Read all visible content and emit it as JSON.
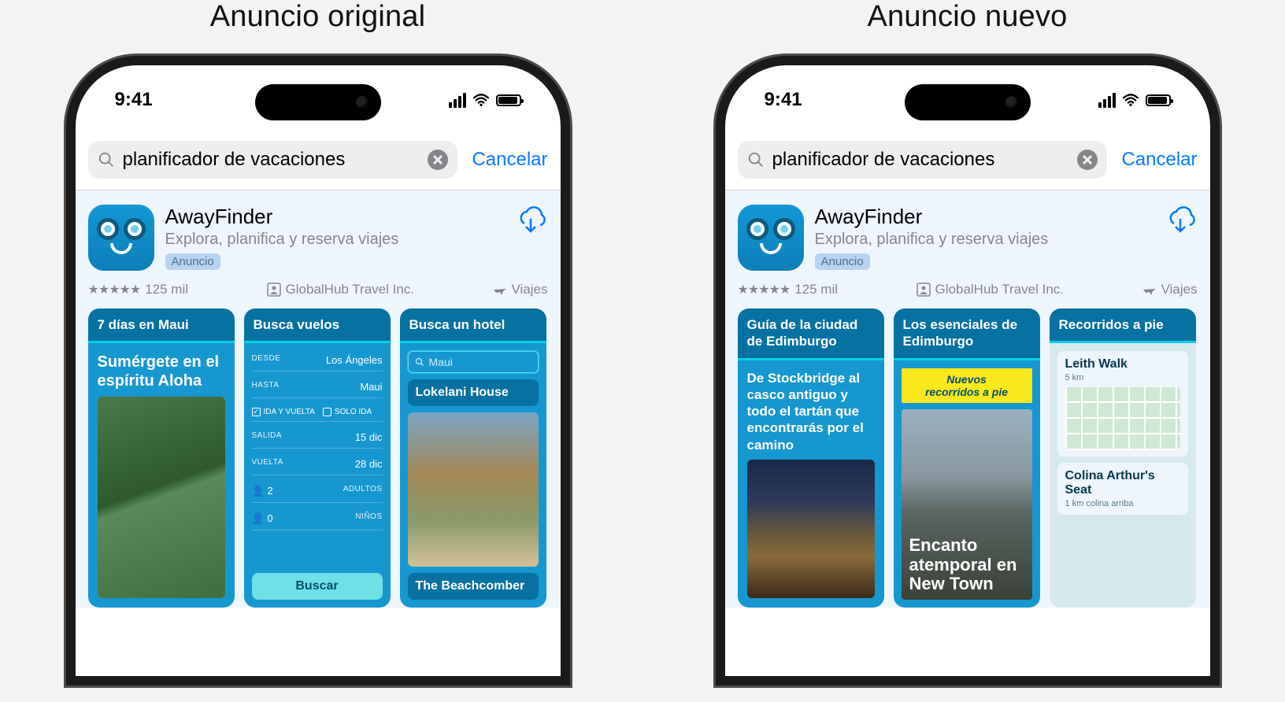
{
  "left": {
    "title": "Anuncio original",
    "status_time": "9:41",
    "search_value": "planificador de vacaciones",
    "cancel": "Cancelar",
    "app": {
      "name": "AwayFinder",
      "subtitle": "Explora, planifica y reserva viajes",
      "ad_label": "Anuncio"
    },
    "meta": {
      "rating_count": "125 mil",
      "developer": "GlobalHub Travel Inc.",
      "category": "Viajes"
    },
    "cards": [
      {
        "title": "7 días en Maui",
        "subhead": "Sumérgete en el espíritu Aloha"
      },
      {
        "title": "Busca vuelos",
        "from_lbl": "DESDE",
        "from_val": "Los Ángeles",
        "to_lbl": "HASTA",
        "to_val": "Maui",
        "cb1": "IDA Y VUELTA",
        "cb2": "SOLO IDA",
        "out_lbl": "SALIDA",
        "out_val": "15 dic",
        "ret_lbl": "VUELTA",
        "ret_val": "28 dic",
        "ad_n": "2",
        "ad_lbl": "ADULTOS",
        "ch_n": "0",
        "ch_lbl": "NIÑOS",
        "btn": "Buscar"
      },
      {
        "title": "Busca un hotel",
        "search_ph": "Maui",
        "h1": "Lokelani House",
        "h2": "The Beachcomber"
      }
    ]
  },
  "right": {
    "title": "Anuncio nuevo",
    "status_time": "9:41",
    "search_value": "planificador de vacaciones",
    "cancel": "Cancelar",
    "app": {
      "name": "AwayFinder",
      "subtitle": "Explora, planifica y reserva viajes",
      "ad_label": "Anuncio"
    },
    "meta": {
      "rating_count": "125 mil",
      "developer": "GlobalHub Travel Inc.",
      "category": "Viajes"
    },
    "cards": [
      {
        "title": "Guía de la ciudad de Edimburgo",
        "desc": "De Stockbridge al casco antiguo y todo el tartán que encontrarás por el camino"
      },
      {
        "title": "Los esenciales de Edimburgo",
        "banner_l1": "Nuevos",
        "banner_l2": "recorridos a pie",
        "overlay": "Encanto atemporal en New Town"
      },
      {
        "title": "Recorridos a pie",
        "w1": {
          "name": "Leith Walk",
          "dist": "5 km"
        },
        "w2": {
          "name": "Colina Arthur's Seat",
          "dist": "1 km colina arriba"
        }
      }
    ]
  }
}
